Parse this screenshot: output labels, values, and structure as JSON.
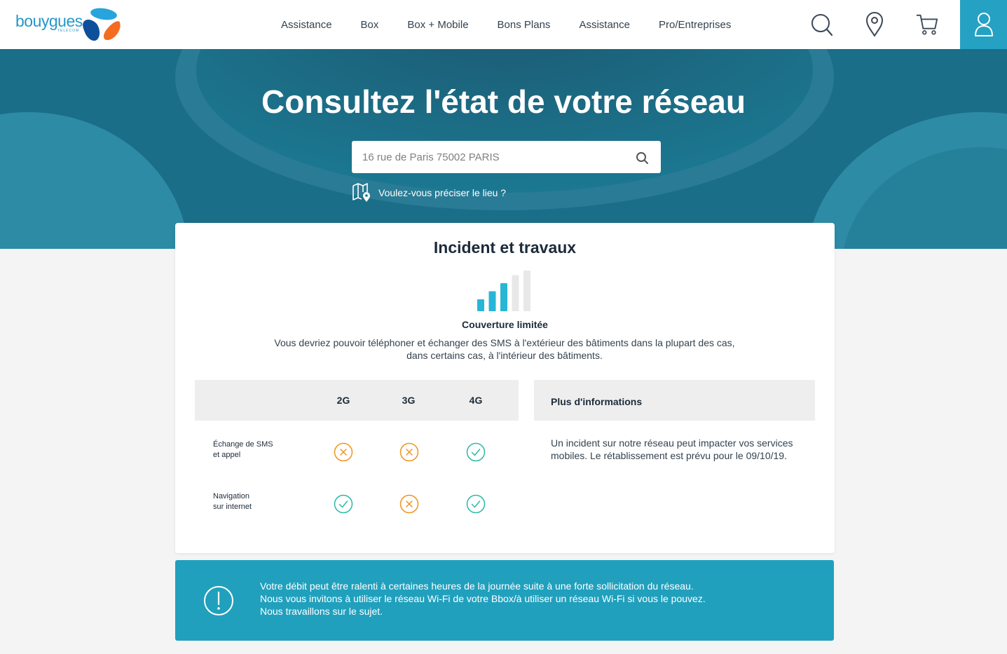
{
  "header": {
    "logo_text": "bouygues",
    "logo_subtext": "TELECOM",
    "nav": [
      "Assistance",
      "Box",
      "Box + Mobile",
      "Bons Plans",
      "Assistance",
      "Pro/Entreprises"
    ],
    "icons": [
      "search-icon",
      "location-pin-icon",
      "cart-icon",
      "user-icon"
    ]
  },
  "hero": {
    "title": "Consultez l'état de votre réseau",
    "search_placeholder": "16 rue de Paris 75002 PARIS",
    "precise_link": "Voulez-vous préciser le lieu ?"
  },
  "card": {
    "title": "Incident et travaux",
    "signal_level": 3,
    "signal_max": 5,
    "coverage_label": "Couverture limitée",
    "coverage_desc_line1": "Vous devriez pouvoir téléphoner et échanger des SMS à l'extérieur des bâtiments dans la plupart des cas,",
    "coverage_desc_line2": "dans certains cas, à l'intérieur des bâtiments.",
    "columns": [
      "2G",
      "3G",
      "4G"
    ],
    "rows": [
      {
        "label_line1": "Échange de SMS",
        "label_line2": "et appel",
        "status": [
          "ko",
          "ko",
          "ok"
        ]
      },
      {
        "label_line1": "Navigation",
        "label_line2": "sur internet",
        "status": [
          "ok",
          "ko",
          "ok"
        ]
      }
    ],
    "info_title": "Plus d'informations",
    "info_text": "Un incident sur notre réseau peut impacter vos services mobiles. Le rétablissement est prévu pour le 09/10/19."
  },
  "alert": {
    "line1": "Votre débit peut être ralenti à certaines heures de la journée suite à une forte sollicitation du réseau.",
    "line2": "Nous vous invitons à utiliser le réseau Wi-Fi de votre Bbox/à utiliser un réseau Wi-Fi si vous le pouvez.",
    "line3": "Nous travaillons sur le sujet."
  },
  "colors": {
    "accent": "#25a1c3",
    "ok": "#2bbaa6",
    "ko": "#f0941e",
    "signal_on": "#27b6d6",
    "signal_off": "#e8e8e8"
  }
}
